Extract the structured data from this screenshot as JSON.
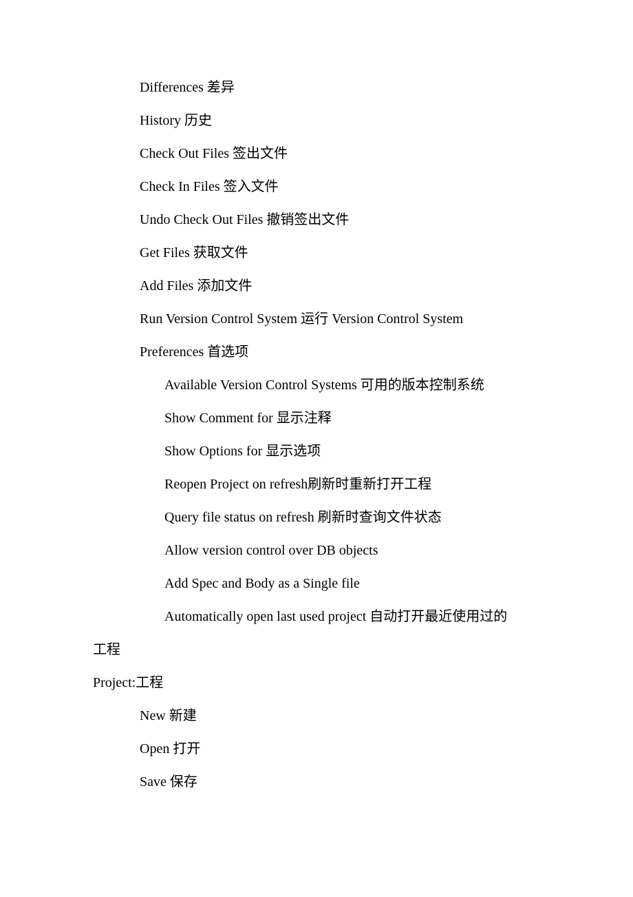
{
  "items": [
    {
      "text": "Differences  差异",
      "indent": 1
    },
    {
      "text": "History  历史",
      "indent": 1
    },
    {
      "text": "Check Out Files  签出文件",
      "indent": 1
    },
    {
      "text": "Check In Files  签入文件",
      "indent": 1
    },
    {
      "text": "Undo Check Out Files  撤销签出文件",
      "indent": 1
    },
    {
      "text": "Get Files  获取文件",
      "indent": 1
    },
    {
      "text": "Add Files  添加文件",
      "indent": 1
    },
    {
      "text": "Run Version Control System  运行 Version Control System",
      "indent": 1
    },
    {
      "text": "Preferences  首选项",
      "indent": 1
    },
    {
      "text": "Available Version Control Systems  可用的版本控制系统",
      "indent": 2
    },
    {
      "text": "Show Comment for  显示注释",
      "indent": 2
    },
    {
      "text": "Show Options for  显示选项",
      "indent": 2
    },
    {
      "text": "Reopen Project on refresh刷新时重新打开工程",
      "indent": 2
    },
    {
      "text": "Query file status on refresh  刷新时查询文件状态",
      "indent": 2
    },
    {
      "text": "Allow version control over DB objects",
      "indent": 2
    },
    {
      "text": "Add Spec and Body as a Single file",
      "indent": 2
    },
    {
      "text": "Automatically open last used project  自动打开最近使用过的",
      "indent": 2
    }
  ],
  "wrap_continuation": "工程",
  "section_header": "Project:工程",
  "project_items": [
    {
      "text": "New  新建",
      "indent": 1
    },
    {
      "text": "Open  打开",
      "indent": 1
    },
    {
      "text": "Save  保存",
      "indent": 1
    }
  ]
}
